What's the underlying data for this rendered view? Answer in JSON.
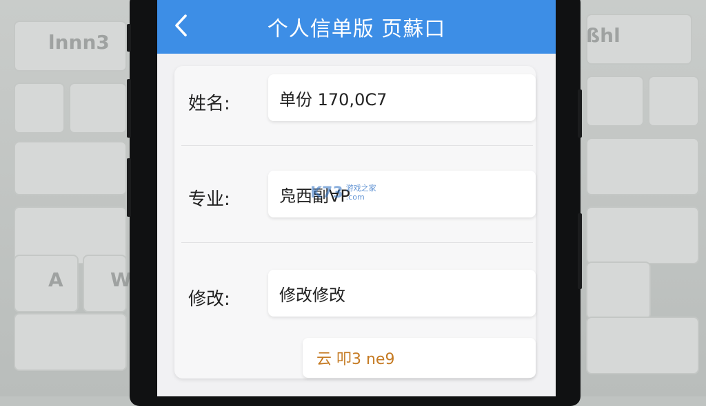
{
  "header": {
    "title": "个人信单版 页蘇口"
  },
  "form": {
    "name_label": "姓名:",
    "name_value": "单份 170,0C7",
    "major_label": "专业:",
    "major_value": "凫西副∀P",
    "edit_label": "修改:",
    "edit_value": "修改修改"
  },
  "watermark": {
    "logo": "K73",
    "line1": "游戏之家",
    "line2": ".com"
  },
  "action": {
    "label": "云 叩3 ne9"
  },
  "background": {
    "key_text_1": "lnnn3",
    "key_text_2": "ßhl",
    "key_text_3": "A",
    "key_text_4": "W"
  },
  "colors": {
    "appbar": "#3d8ee6",
    "action_text": "#c57a22"
  },
  "icons": {
    "back": "chevron-left-icon"
  }
}
